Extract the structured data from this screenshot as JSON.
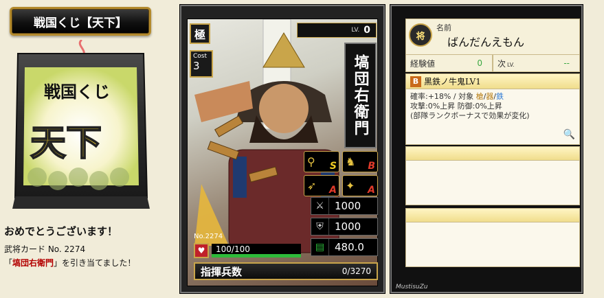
{
  "title": "戦国くじ【天下】",
  "kuji": {
    "label_top": "戦国くじ",
    "label_main": "天下"
  },
  "intro": {
    "congrats": "おめでとうございます！",
    "card_no": "武将カード No. 2274",
    "drew_prefix": "「",
    "drew_name": "塙団右衛門",
    "drew_suffix": "」を引き当てました！"
  },
  "card": {
    "rank": "極",
    "cost_label": "Cost",
    "cost": "3",
    "lv_label": "LV.",
    "lv": "0",
    "name": "塙団右衛門",
    "skills": [
      {
        "icon": "spear-icon",
        "glyph": "⚲",
        "grade": "S"
      },
      {
        "icon": "horse-icon",
        "glyph": "♞",
        "grade": "B"
      },
      {
        "icon": "bow-icon",
        "glyph": "➶",
        "grade": "A"
      },
      {
        "icon": "cannon-icon",
        "glyph": "✦",
        "grade": "A"
      }
    ],
    "attack": "1000",
    "defense": "1000",
    "intelligence": "480.0",
    "no_label": "No.2274",
    "hp": "100/100",
    "hp_fraction": 1.0,
    "command_label": "指揮兵数",
    "command_value": "0/3270"
  },
  "info": {
    "name_icon": "将",
    "name_label": "名前",
    "name": "ばんだんえもん",
    "exp_label": "経験値",
    "exp": "0",
    "next_label": "次",
    "next_sub": "LV.",
    "next": "--",
    "skill_grade": "B",
    "skill_name": "黒鉄ノ牛鬼LV1",
    "skill_line1_a": "確率:+18%  /  対象 ",
    "skill_target_1": "槍",
    "skill_sep_1": "/",
    "skill_target_2": "器",
    "skill_sep_2": "/",
    "skill_target_3": "鉄",
    "skill_line2": "攻撃:0%上昇  防御:0%上昇",
    "skill_line3": "(部隊ランクボーナスで効果が変化)",
    "credit": "MustisuZu"
  }
}
